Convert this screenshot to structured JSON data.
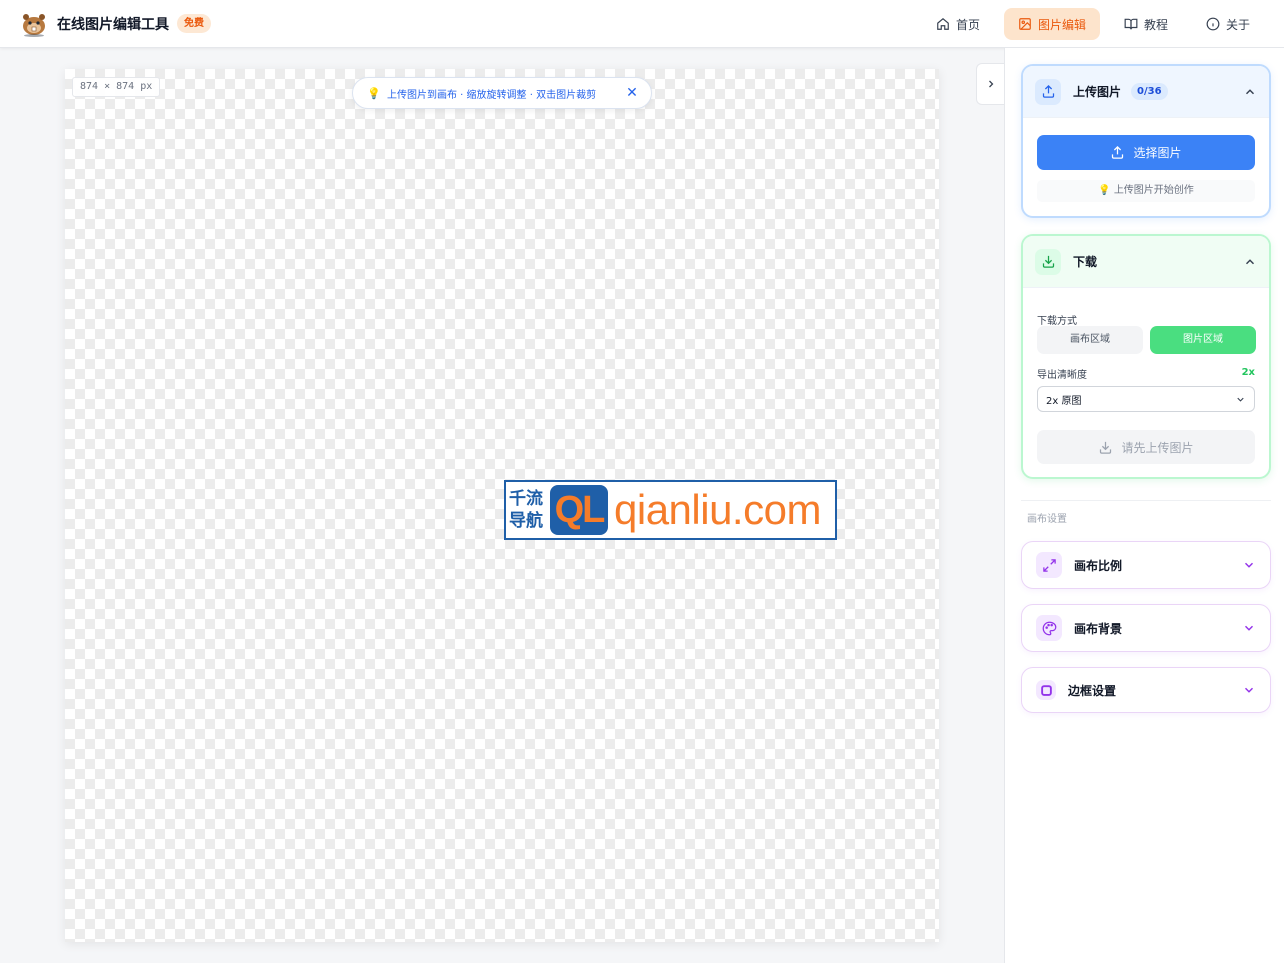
{
  "header": {
    "title": "在线图片编辑工具",
    "badge": "免费",
    "nav": [
      {
        "label": "首页",
        "icon": "home-icon",
        "active": false
      },
      {
        "label": "图片编辑",
        "icon": "image-icon",
        "active": true
      },
      {
        "label": "教程",
        "icon": "book-icon",
        "active": false
      },
      {
        "label": "关于",
        "icon": "info-icon",
        "active": false
      }
    ]
  },
  "canvas": {
    "size_label": "874 × 874 px",
    "tip": "上传图片到画布 · 缩放旋转调整 · 双击图片裁剪",
    "image": {
      "cn_line1": "千流",
      "cn_line2": "导航",
      "mark": "QL",
      "domain": "qianliu.com"
    }
  },
  "upload": {
    "title": "上传图片",
    "count": "0/36",
    "button": "选择图片",
    "hint": "上传图片开始创作"
  },
  "download": {
    "title": "下载",
    "mode_label": "下载方式",
    "mode_options": [
      "画布区域",
      "图片区域"
    ],
    "mode_selected": "图片区域",
    "quality_label": "导出清晰度",
    "quality_value": "2x",
    "quality_select": "2x 原图",
    "button": "请先上传图片"
  },
  "canvas_settings": {
    "label": "画布设置",
    "items": [
      {
        "title": "画布比例",
        "icon": "expand-icon"
      },
      {
        "title": "画布背景",
        "icon": "palette-icon"
      },
      {
        "title": "边框设置",
        "icon": "border-icon"
      }
    ]
  },
  "colors": {
    "accent_orange": "#ea580c",
    "primary_blue": "#3b82f6",
    "success_green": "#4ade80",
    "purple": "#9333ea"
  }
}
